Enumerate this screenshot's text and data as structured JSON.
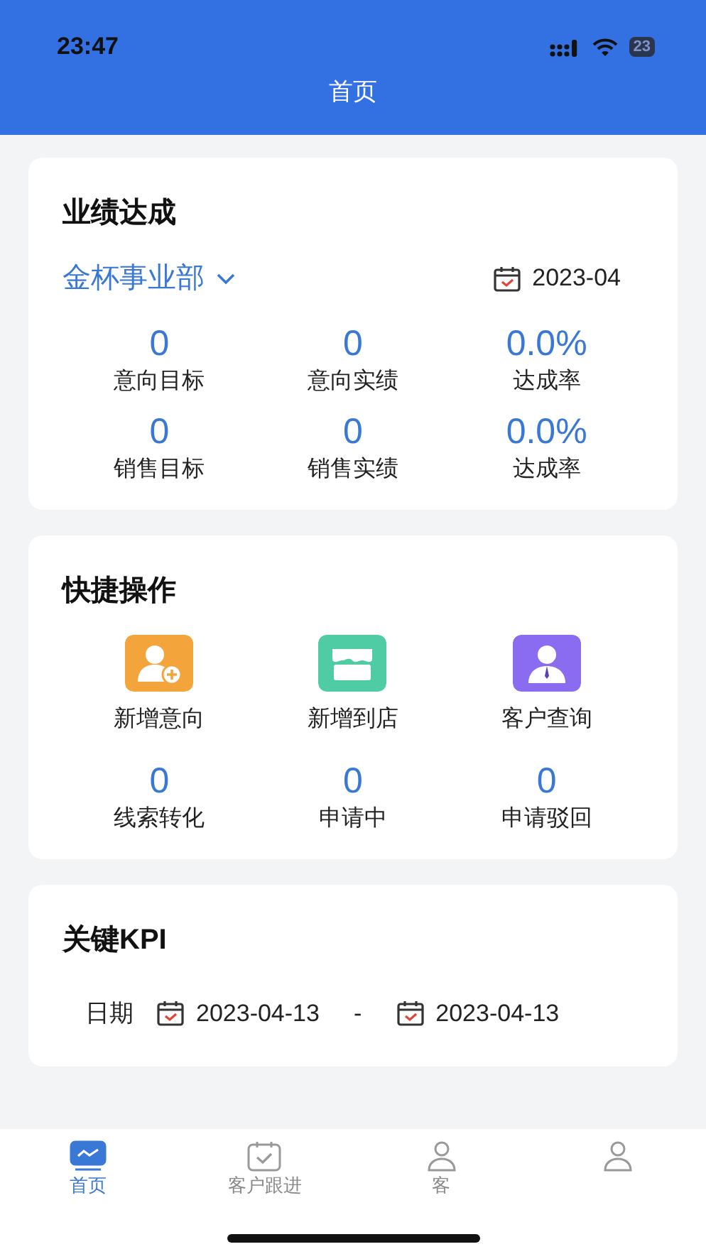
{
  "status_bar": {
    "time": "23:47",
    "battery": "23"
  },
  "header": {
    "title": "首页"
  },
  "performance": {
    "title": "业绩达成",
    "department": "金杯事业部",
    "month": "2023-04",
    "stats": [
      {
        "value": "0",
        "label": "意向目标"
      },
      {
        "value": "0",
        "label": "意向实绩"
      },
      {
        "value": "0.0%",
        "label": "达成率"
      },
      {
        "value": "0",
        "label": "销售目标"
      },
      {
        "value": "0",
        "label": "销售实绩"
      },
      {
        "value": "0.0%",
        "label": "达成率"
      }
    ]
  },
  "quick_actions": {
    "title": "快捷操作",
    "actions": [
      {
        "kind": "add-person",
        "label": "新增意向",
        "color": "#f3a53c"
      },
      {
        "kind": "store",
        "label": "新增到店",
        "color": "#4fcca4"
      },
      {
        "kind": "person",
        "label": "客户查询",
        "color": "#8a6cf0"
      }
    ],
    "counts": [
      {
        "value": "0",
        "label": "线索转化"
      },
      {
        "value": "0",
        "label": "申请中"
      },
      {
        "value": "0",
        "label": "申请驳回"
      }
    ]
  },
  "kpi": {
    "title": "关键KPI",
    "date_label": "日期",
    "start": "2023-04-13",
    "separator": "-",
    "end": "2023-04-13"
  },
  "tabs": [
    {
      "kind": "chart",
      "label": "首页",
      "selected": true
    },
    {
      "kind": "calendar",
      "label": "客户跟进",
      "selected": false
    },
    {
      "kind": "person",
      "label": "客",
      "selected": false
    },
    {
      "kind": "person",
      "selected": false
    }
  ]
}
